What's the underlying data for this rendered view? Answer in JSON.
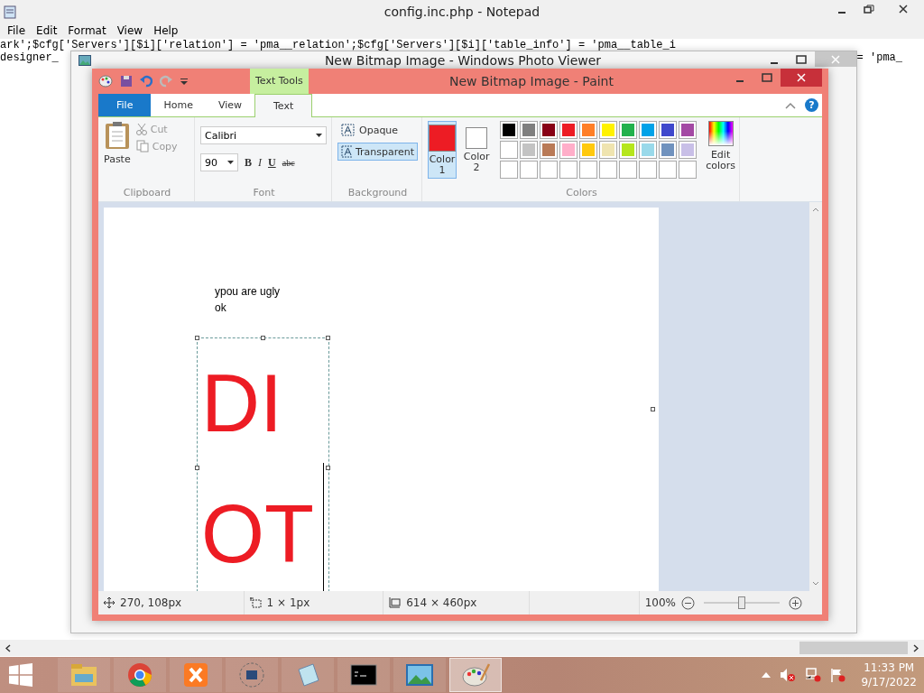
{
  "notepad": {
    "title": "config.inc.php - Notepad",
    "menu": [
      "File",
      "Edit",
      "Format",
      "View",
      "Help"
    ],
    "line_1": "ark';$cfg['Servers'][$i]['relation'] = 'pma__relation';$cfg['Servers'][$i]['table_info'] = 'pma__table_i",
    "line_2_left": "designer_",
    "line_2_right": "= 'pma_"
  },
  "photo_viewer": {
    "title": "New Bitmap Image - Windows Photo Viewer"
  },
  "paint": {
    "title": "New Bitmap Image - Paint",
    "context_tab": "Text Tools",
    "tabs": [
      {
        "label": "File",
        "kind": "file",
        "selected": false
      },
      {
        "label": "Home",
        "kind": "tab",
        "selected": false
      },
      {
        "label": "View",
        "kind": "tab",
        "selected": false
      },
      {
        "label": "Text",
        "kind": "tab",
        "selected": true
      }
    ],
    "clipboard": {
      "paste": "Paste",
      "cut": {
        "label": "Cut",
        "disabled": true
      },
      "copy": {
        "label": "Copy",
        "disabled": true
      },
      "group": "Clipboard"
    },
    "font": {
      "family": "Calibri",
      "size": "90",
      "bold": "B",
      "italic": "I",
      "underline": "U",
      "strike": "abc",
      "group": "Font"
    },
    "background": {
      "options": [
        {
          "label": "Opaque",
          "selected": false
        },
        {
          "label": "Transparent",
          "selected": true
        }
      ],
      "group": "Background"
    },
    "colors": {
      "slots": [
        {
          "label": "Color\n1",
          "color": "#ed1c24",
          "selected": true
        },
        {
          "label": "Color\n2",
          "color": "#ffffff",
          "selected": false
        }
      ],
      "palette": [
        {
          "color": "#000000"
        },
        {
          "color": "#7f7f7f"
        },
        {
          "color": "#880015"
        },
        {
          "color": "#ed1c24"
        },
        {
          "color": "#ff7f27"
        },
        {
          "color": "#fff200"
        },
        {
          "color": "#22b14c"
        },
        {
          "color": "#00a2e8"
        },
        {
          "color": "#3f48cc"
        },
        {
          "color": "#a349a4"
        },
        {
          "color": "#ffffff"
        },
        {
          "color": "#c3c3c3"
        },
        {
          "color": "#b97a57"
        },
        {
          "color": "#ffaec9"
        },
        {
          "color": "#ffc90e"
        },
        {
          "color": "#efe4b0"
        },
        {
          "color": "#b5e61d"
        },
        {
          "color": "#99d9ea"
        },
        {
          "color": "#7092be"
        },
        {
          "color": "#c8bfe7"
        }
      ],
      "edit": "Edit\ncolors",
      "group": "Colors"
    },
    "canvas": {
      "small_text": [
        "ypou are ugly",
        "ok"
      ],
      "big_text": [
        "DI",
        "OT"
      ]
    },
    "status": {
      "cursor": "270, 108px",
      "selection": "1 × 1px",
      "size": "614 × 460px",
      "zoom": "100%",
      "level": 0.5
    },
    "help": "?"
  },
  "taskbar": {
    "apps": [
      {
        "kind": "folder",
        "selected": false
      },
      {
        "kind": "chrome",
        "selected": false
      },
      {
        "kind": "xampp",
        "selected": false
      },
      {
        "kind": "disc",
        "selected": false
      },
      {
        "kind": "notepad",
        "selected": false
      },
      {
        "kind": "cmd",
        "selected": false
      },
      {
        "kind": "photo",
        "selected": false
      },
      {
        "kind": "paint",
        "selected": true
      }
    ],
    "time": "11:33 PM",
    "date": "9/17/2022"
  }
}
